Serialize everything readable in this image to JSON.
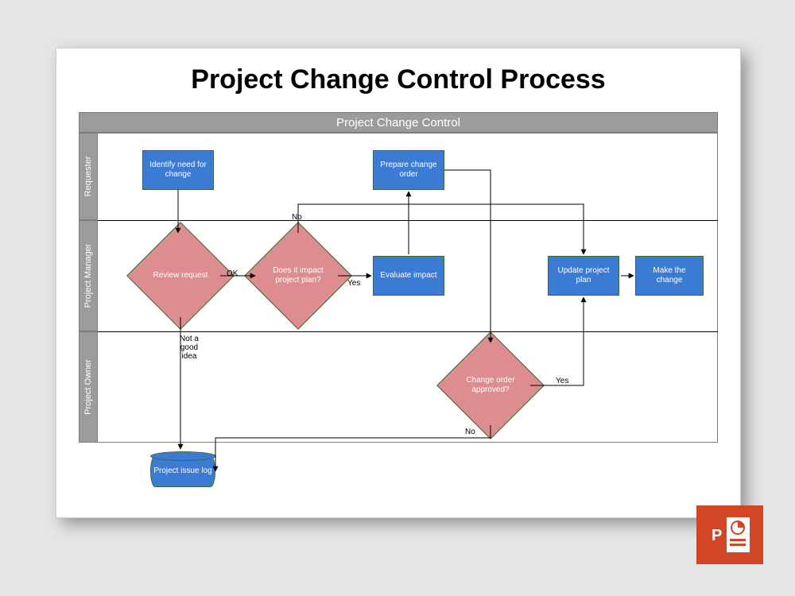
{
  "title": "Project Change Control Process",
  "header": "Project Change Control",
  "lanes": [
    "Requester",
    "Project Manager",
    "Project Owner"
  ],
  "nodes": {
    "identify": "Identify need for change",
    "prepare": "Prepare change order",
    "review": "Review request",
    "impact_q": "Does it impact project plan?",
    "evaluate": "Evaluate impact",
    "update": "Update project plan",
    "make": "Make the change",
    "approved": "Change order approved?",
    "log": "Project issue log"
  },
  "edges": {
    "ok": "OK",
    "no": "No",
    "yes": "Yes",
    "not": "Not a good idea",
    "no2": "No",
    "yes2": "Yes"
  },
  "badge": "PowerPoint"
}
